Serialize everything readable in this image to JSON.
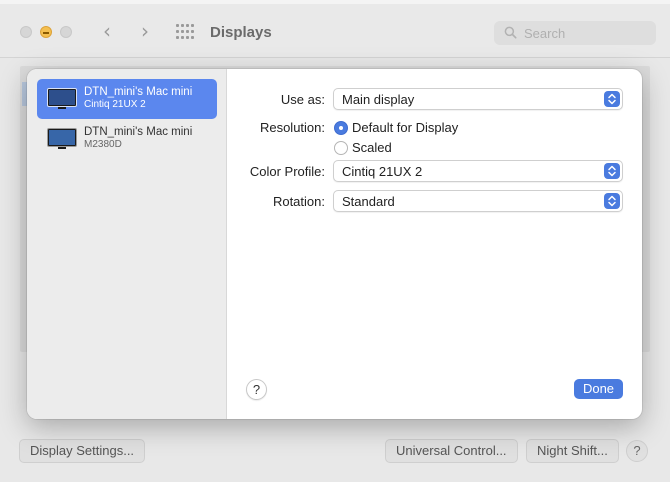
{
  "window": {
    "title": "Displays",
    "search_placeholder": "Search",
    "back_icon": "chevron-left-icon",
    "forward_icon": "chevron-right-icon",
    "grid_icon": "show-all-grid-icon"
  },
  "footer": {
    "display_settings_label": "Display Settings...",
    "universal_control_label": "Universal Control...",
    "night_shift_label": "Night Shift...",
    "help_label": "?"
  },
  "sheet": {
    "displays": [
      {
        "name": "DTN_mini's Mac mini",
        "model": "Cintiq 21UX 2",
        "selected": true
      },
      {
        "name": "DTN_mini's Mac mini",
        "model": "M2380D",
        "selected": false
      }
    ],
    "use_as": {
      "label": "Use as:",
      "value": "Main display"
    },
    "resolution": {
      "label": "Resolution:",
      "options": [
        "Default for Display",
        "Scaled"
      ],
      "selected": "Default for Display"
    },
    "color_profile": {
      "label": "Color Profile:",
      "value": "Cintiq 21UX 2"
    },
    "rotation": {
      "label": "Rotation:",
      "value": "Standard"
    },
    "help_label": "?",
    "done_label": "Done"
  },
  "colors": {
    "accent": "#4a7bdf",
    "selection": "#5b87ee",
    "minimize": "#f4bf4f"
  }
}
